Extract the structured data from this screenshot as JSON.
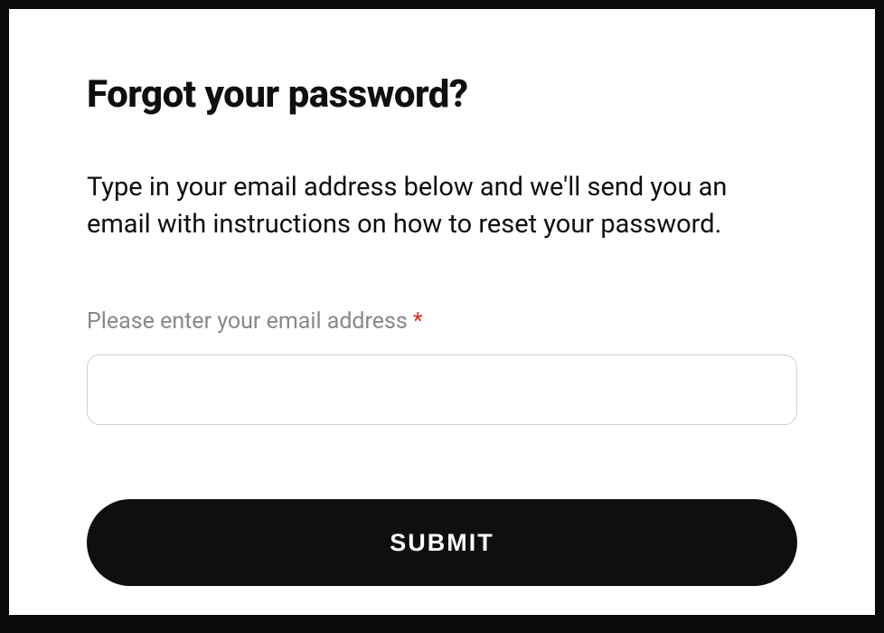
{
  "modal": {
    "title": "Forgot your password?",
    "description": "Type in your email address below and we'll send you an email with instructions on how to reset your password.",
    "email_field": {
      "label": "Please enter your email address",
      "required_mark": "*",
      "value": ""
    },
    "submit_label": "SUBMIT"
  }
}
